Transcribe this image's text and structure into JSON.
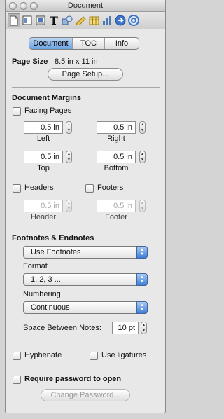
{
  "window": {
    "title": "Document"
  },
  "tabs": [
    {
      "label": "Document",
      "selected": true
    },
    {
      "label": "TOC",
      "selected": false
    },
    {
      "label": "Info",
      "selected": false
    }
  ],
  "page_size": {
    "label": "Page Size",
    "value": "8.5 in x 11 in",
    "setup_button": "Page Setup..."
  },
  "margins": {
    "heading": "Document Margins",
    "facing_pages": "Facing Pages",
    "left": {
      "value": "0.5 in",
      "label": "Left"
    },
    "right": {
      "value": "0.5 in",
      "label": "Right"
    },
    "top": {
      "value": "0.5 in",
      "label": "Top"
    },
    "bottom": {
      "value": "0.5 in",
      "label": "Bottom"
    }
  },
  "headers_footers": {
    "headers_label": "Headers",
    "footers_label": "Footers",
    "header": {
      "value": "0.5 in",
      "label": "Header"
    },
    "footer": {
      "value": "0.5 in",
      "label": "Footer"
    }
  },
  "footnotes": {
    "heading": "Footnotes & Endnotes",
    "type_value": "Use Footnotes",
    "format_label": "Format",
    "format_value": "1, 2, 3 ...",
    "numbering_label": "Numbering",
    "numbering_value": "Continuous",
    "space_label": "Space Between Notes:",
    "space_value": "10 pt"
  },
  "options": {
    "hyphenate": "Hyphenate",
    "ligatures": "Use ligatures"
  },
  "password": {
    "label": "Require password to open",
    "change_button": "Change Password..."
  },
  "colors": {
    "accent": "#6aa2e4",
    "popup_arrow": "#3e7ed9"
  }
}
